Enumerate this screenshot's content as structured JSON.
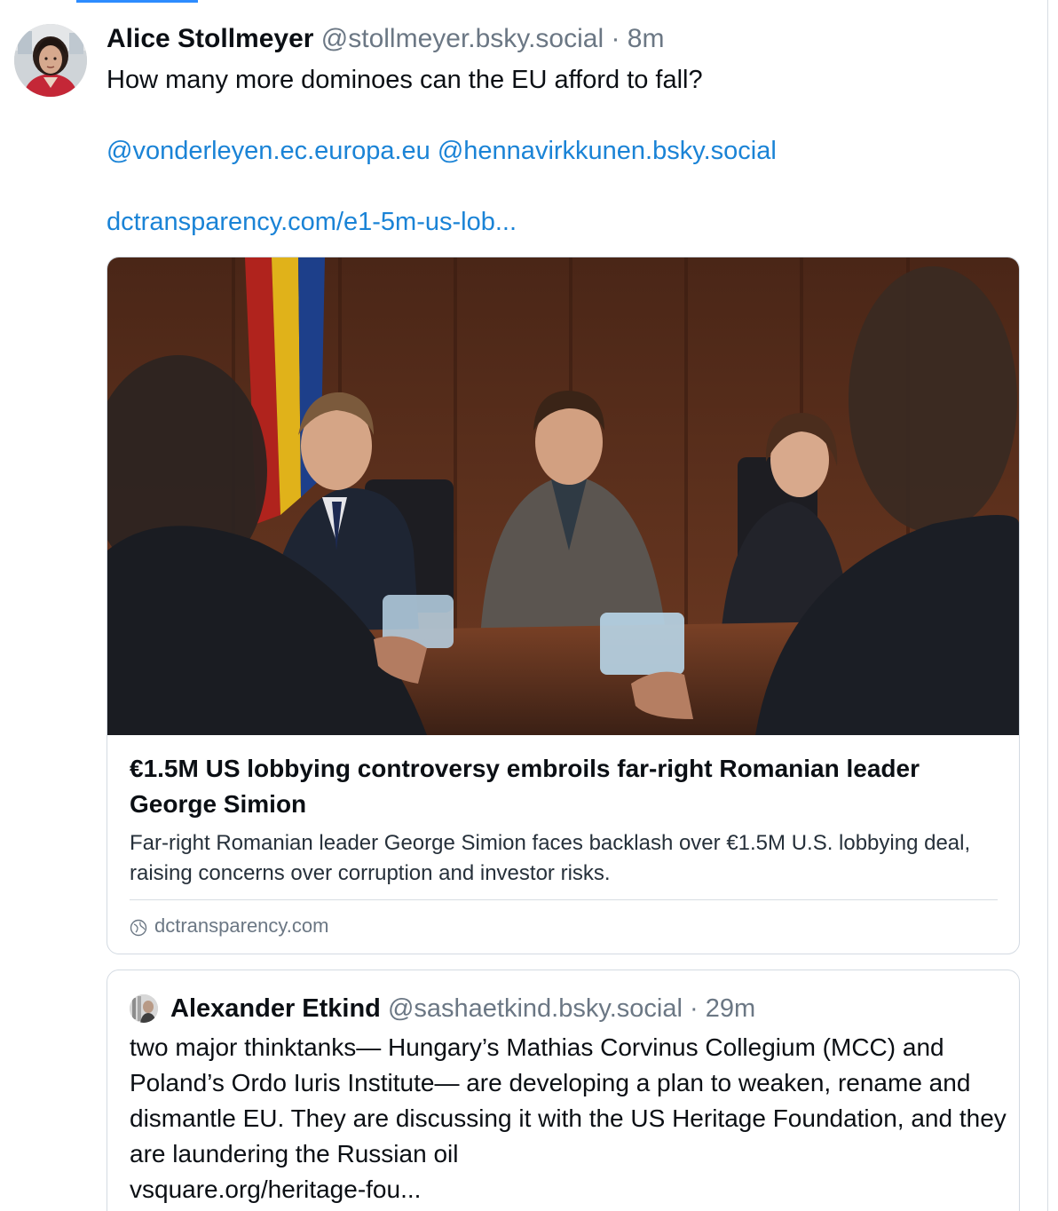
{
  "post": {
    "author_name": "Alice Stollmeyer",
    "author_handle": "@stollmeyer.bsky.social",
    "separator": "·",
    "timestamp": "8m",
    "text": "How many more dominoes can the EU afford to fall?",
    "mentions": [
      "@vonderleyen.ec.europa.eu",
      "@hennavirkkunen.bsky.social"
    ],
    "link_text": "dctransparency.com/e1-5m-us-lob...",
    "avatar_icon": "user-avatar-photo"
  },
  "link_card": {
    "title": "€1.5M US lobbying controversy embroils far-right Romanian leader George Simion",
    "description": "Far-right Romanian leader George Simion faces backlash over €1.5M U.S. lobbying deal, raising concerns over corruption and investor risks.",
    "domain": "dctransparency.com",
    "domain_icon": "globe-icon"
  },
  "quote": {
    "author_name": "Alexander Etkind",
    "author_handle": "@sashaetkind.bsky.social",
    "separator": "·",
    "timestamp": "29m",
    "text": "two major thinktanks— Hungary’s Mathias Corvinus Collegium (MCC) and Poland’s Ordo Iuris Institute— are developing a plan to weaken, rename and dismantle EU. They are discussing it with the US Heritage Foundation, and they are laundering the Russian oil",
    "link_text": "vsquare.org/heritage-fou..."
  },
  "colors": {
    "link": "#1a83d6",
    "muted": "#6b7784",
    "border": "#d3dae2",
    "accent": "#2d8cff"
  }
}
